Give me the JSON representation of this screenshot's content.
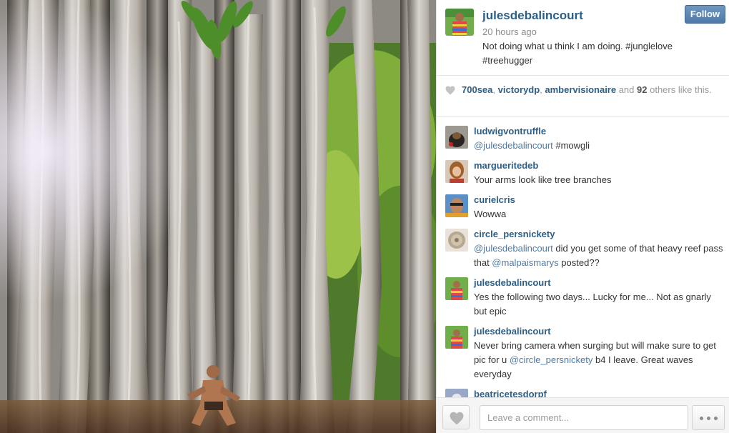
{
  "post": {
    "username": "julesdebalincourt",
    "time": "20 hours ago",
    "caption": "Not doing what u think I am doing. #junglelove #treehugger",
    "follow_label": "Follow"
  },
  "likes": {
    "users": [
      "700sea",
      "victorydp",
      "ambervisionaire"
    ],
    "sep1": ", ",
    "sep2": ", ",
    "and_text": " and ",
    "others_count": "92",
    "others_text": " others like this."
  },
  "comments": [
    {
      "user": "ludwigvontruffle",
      "mention": "@julesdebalincourt",
      "text": " #mowgli"
    },
    {
      "user": "margueritedeb",
      "text": "Your arms look like tree branches"
    },
    {
      "user": "curielcris",
      "text": "Wowwa"
    },
    {
      "user": "circle_persnickety",
      "mention": "@julesdebalincourt",
      "text": " did you get some of that heavy reef pass that ",
      "mention2": "@malpaismarys",
      "text2": " posted??"
    },
    {
      "user": "julesdebalincourt",
      "text": "Yes the following two days... Lucky for me... Not as gnarly but epic"
    },
    {
      "user": "julesdebalincourt",
      "text": "Never bring camera when surging but will make sure to get pic for u ",
      "mention": "@circle_persnickety",
      "text2": " b4 I leave. Great waves everyday"
    },
    {
      "user": "beatricetesdorpf",
      "text": ""
    }
  ],
  "comment_box": {
    "placeholder": "Leave a comment..."
  },
  "icons": {
    "heart": "heart-icon",
    "more": "more-dots-icon"
  },
  "colors": {
    "link": "#2d5f86",
    "follow_button": "#5a84ae"
  }
}
